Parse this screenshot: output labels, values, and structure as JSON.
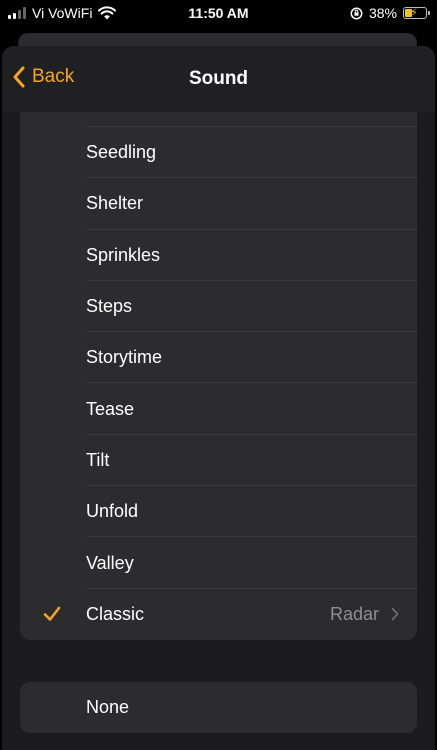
{
  "status_bar": {
    "carrier": "Vi VoWiFi",
    "time": "11:50 AM",
    "battery_percent": "38%"
  },
  "nav": {
    "back_label": "Back",
    "title": "Sound"
  },
  "list": {
    "partial_item": "",
    "items": [
      "Seedling",
      "Shelter",
      "Sprinkles",
      "Steps",
      "Storytime",
      "Tease",
      "Tilt",
      "Unfold",
      "Valley"
    ],
    "selected": {
      "label": "Classic",
      "detail": "Radar"
    }
  },
  "none_option": {
    "label": "None"
  },
  "colors": {
    "accent": "#f5a623",
    "background": "#1c1c1e",
    "cell": "#2c2c2e",
    "secondary_text": "#8e8e93"
  }
}
